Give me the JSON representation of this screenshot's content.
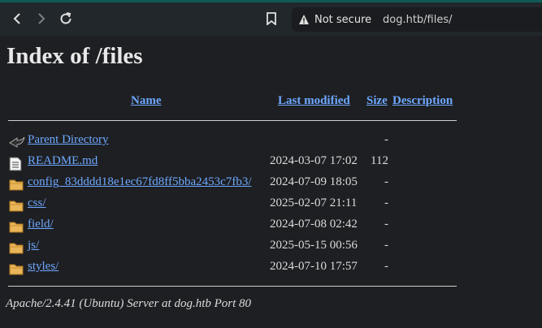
{
  "browser": {
    "security_label": "Not secure",
    "url": "dog.htb/files/"
  },
  "page": {
    "title": "Index of /files",
    "columns": {
      "name": "Name",
      "last_modified": "Last modified",
      "size": "Size",
      "description": "Description"
    },
    "rows": [
      {
        "icon": "back-icon",
        "name": "Parent Directory",
        "modified": "",
        "size": "-"
      },
      {
        "icon": "text-file-icon",
        "name": "README.md",
        "modified": "2024-03-07 17:02",
        "size": "112"
      },
      {
        "icon": "folder-icon",
        "name": "config_83dddd18e1ec67fd8ff5bba2453c7fb3/",
        "modified": "2024-07-09 18:05",
        "size": "-"
      },
      {
        "icon": "folder-icon",
        "name": "css/",
        "modified": "2025-02-07 21:11",
        "size": "-"
      },
      {
        "icon": "folder-icon",
        "name": "field/",
        "modified": "2024-07-08 02:42",
        "size": "-"
      },
      {
        "icon": "folder-icon",
        "name": "js/",
        "modified": "2025-05-15 00:56",
        "size": "-"
      },
      {
        "icon": "folder-icon",
        "name": "styles/",
        "modified": "2024-07-10 17:57",
        "size": "-"
      }
    ],
    "footer": "Apache/2.4.41 (Ubuntu) Server at dog.htb Port 80"
  }
}
